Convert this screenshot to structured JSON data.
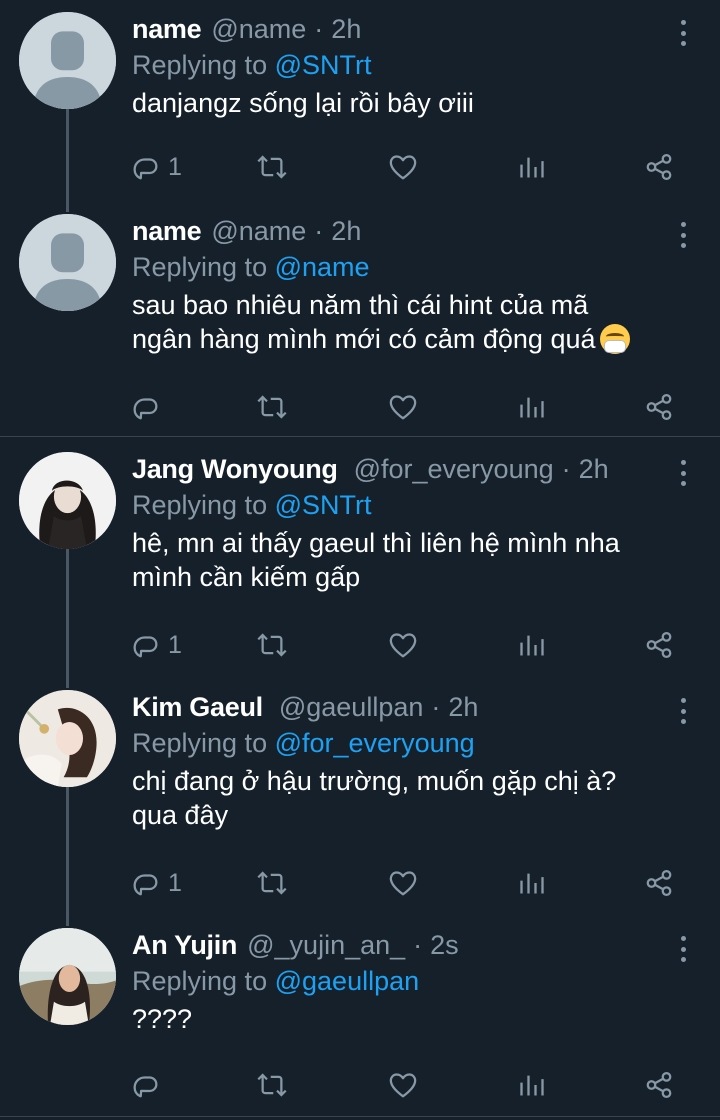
{
  "colors": {
    "background": "#15202b",
    "accent": "#1da1f2",
    "secondary_text": "#8899a6",
    "thread_line": "#4a5866",
    "divider": "#38444d"
  },
  "tweets": [
    {
      "name": "name",
      "handle": "@name",
      "dot": "·",
      "time": "2h",
      "replying_prefix": "Replying to",
      "replying_to": "@SNTrt",
      "text": "danjangz sống lại rồi bây ơiii",
      "reply_count": "1",
      "avatar": "default-avatar"
    },
    {
      "name": "name",
      "handle": "@name",
      "dot": "·",
      "time": "2h",
      "replying_prefix": "Replying to",
      "replying_to": "@name",
      "text_line1": "sau bao nhiêu năm thì cái hint của mã",
      "text_line2": "ngân hàng mình mới có cảm động quá",
      "emoji": "sneezing-face-emoji",
      "avatar": "default-avatar"
    },
    {
      "name": "Jang Wonyoung",
      "handle": "@for_everyoung",
      "dot": "·",
      "time": "2h",
      "replying_prefix": "Replying to",
      "replying_to": "@SNTrt",
      "text_line1": "hê, mn ai thấy gaeul thì liên hệ mình nha",
      "text_line2": "mình cần kiếm gấp",
      "reply_count": "1",
      "avatar": "photo-avatar"
    },
    {
      "name": "Kim Gaeul",
      "handle": "@gaeullpan",
      "dot": "·",
      "time": "2h",
      "replying_prefix": "Replying to",
      "replying_to": "@for_everyoung",
      "text_line1": "chị đang ở hậu trường, muốn gặp chị à?",
      "text_line2": "qua đây",
      "reply_count": "1",
      "avatar": "photo-avatar"
    },
    {
      "name": "An Yujin",
      "handle": "@_yujin_an_",
      "dot": "·",
      "time": "2s",
      "replying_prefix": "Replying to",
      "replying_to": "@gaeullpan",
      "text": "????",
      "avatar": "photo-avatar"
    }
  ],
  "icons": {
    "reply": "reply-bubble-icon",
    "retweet": "retweet-icon",
    "like": "heart-icon",
    "analytics": "bar-chart-icon",
    "share": "share-icon",
    "more": "vertical-dots-icon"
  }
}
